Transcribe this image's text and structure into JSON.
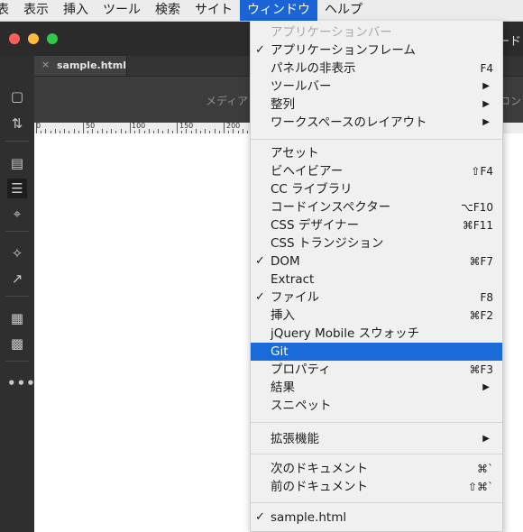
{
  "menubar": {
    "items": [
      "表",
      "表示",
      "挿入",
      "ツール",
      "検索",
      "サイト",
      "ウィンドウ",
      "ヘルプ"
    ],
    "active_index": 6
  },
  "window": {
    "title_fragment": "ード",
    "tab_close": "×",
    "tab_label": "sample.html",
    "view_media": "メディア",
    "view_code": "コン"
  },
  "ruler": {
    "labels": [
      "0",
      "50",
      "100",
      "150",
      "200"
    ]
  },
  "toolbar_icons": [
    "file-icon",
    "transfer-icon",
    "preview-icon",
    "align-icon",
    "target-icon",
    "expand-icon",
    "wand-icon",
    "comment-icon",
    "comment-check-icon",
    "more-icon"
  ],
  "menu": {
    "items": [
      {
        "label": "アプリケーションバー",
        "disabled": true
      },
      {
        "label": "アプリケーションフレーム",
        "check": "✓"
      },
      {
        "label": "パネルの非表示",
        "shortcut": "F4"
      },
      {
        "label": "ツールバー",
        "arrow": "▶"
      },
      {
        "label": "整列",
        "arrow": "▶"
      },
      {
        "label": "ワークスペースのレイアウト",
        "arrow": "▶"
      },
      {
        "label": "アセット"
      },
      {
        "label": "ビヘイビアー",
        "shortcut": "⇧F4"
      },
      {
        "label": "CC ライブラリ"
      },
      {
        "label": "コードインスペクター",
        "shortcut": "⌥F10"
      },
      {
        "label": "CSS デザイナー",
        "shortcut": "⌘F11"
      },
      {
        "label": "CSS トランジション"
      },
      {
        "label": "DOM",
        "check": "✓",
        "shortcut": "⌘F7"
      },
      {
        "label": "Extract"
      },
      {
        "label": "ファイル",
        "check": "✓",
        "shortcut": "F8"
      },
      {
        "label": "挿入",
        "shortcut": "⌘F2"
      },
      {
        "label": "jQuery Mobile スウォッチ"
      },
      {
        "label": "Git",
        "highlighted": true
      },
      {
        "label": "プロパティ",
        "shortcut": "⌘F3"
      },
      {
        "label": "結果",
        "arrow": "▶"
      },
      {
        "label": "スニペット"
      },
      {
        "label": "拡張機能",
        "arrow": "▶"
      },
      {
        "label": "次のドキュメント",
        "shortcut": "⌘`"
      },
      {
        "label": "前のドキュメント",
        "shortcut": "⇧⌘`"
      },
      {
        "label": "sample.html",
        "check": "✓"
      }
    ]
  }
}
